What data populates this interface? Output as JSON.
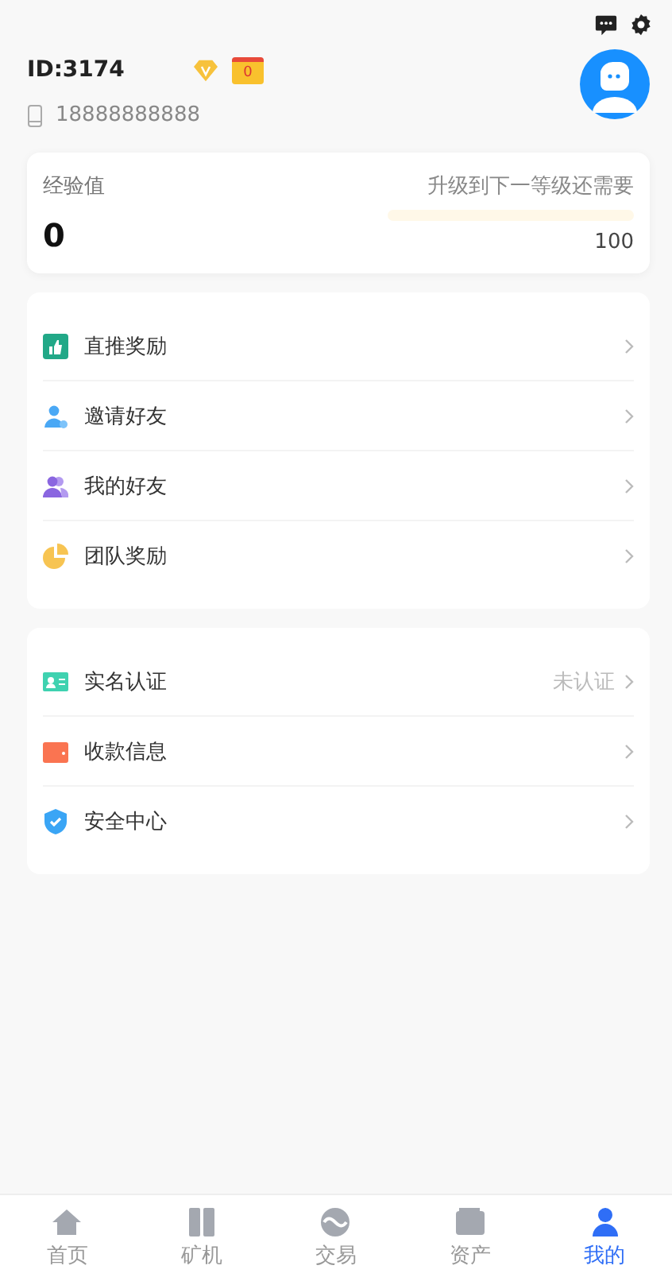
{
  "profile": {
    "id": "ID:3174",
    "crown_level": "0",
    "phone": "18888888888"
  },
  "experience": {
    "label": "经验值",
    "value": "0",
    "upgrade_label": "升级到下一等级还需要",
    "level": 0,
    "target": "100"
  },
  "menu_groups": [
    {
      "items": [
        {
          "label": "直推奖励"
        },
        {
          "label": "邀请好友"
        },
        {
          "label": "我的好友"
        },
        {
          "label": "团队奖励"
        }
      ]
    },
    {
      "items": [
        {
          "label": "实名认证",
          "status": "未认证"
        },
        {
          "label": "收款信息"
        },
        {
          "label": "安全中心"
        }
      ]
    }
  ],
  "tab_bar": [
    {
      "label": "首页",
      "selected": false
    },
    {
      "label": "矿机",
      "selected": false
    },
    {
      "label": "交易",
      "selected": false
    },
    {
      "label": "资产",
      "selected": false
    },
    {
      "label": "我的",
      "selected": true
    }
  ]
}
